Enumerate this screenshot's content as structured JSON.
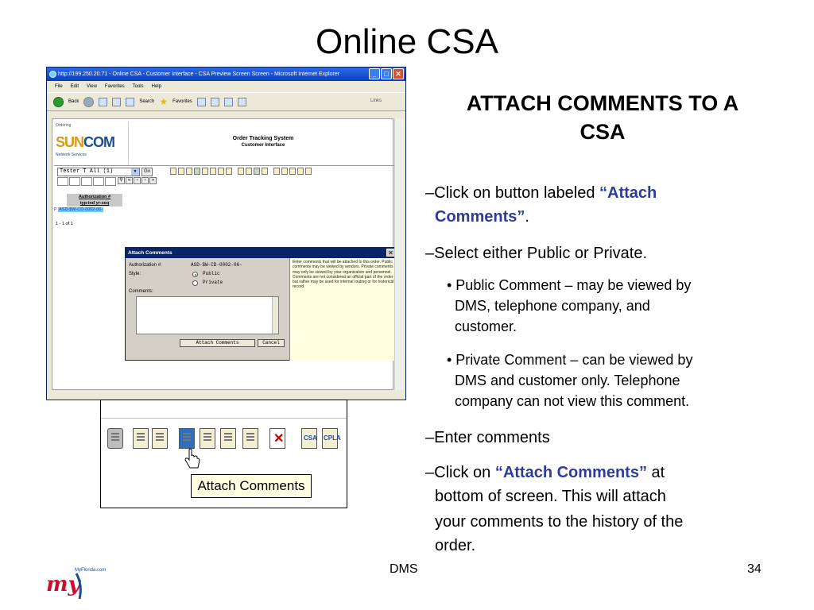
{
  "slide": {
    "title": "Online CSA",
    "heading_line1": "ATTACH COMMENTS TO A",
    "heading_line2": "CSA",
    "bullets": [
      {
        "prefix": "–Click on button labeled ",
        "highlight": "“Attach",
        "line2_highlight": "Comments”",
        "line2_suffix": "."
      },
      {
        "text": "–Select either Public or Private."
      },
      {
        "line1": "• Public Comment – may be viewed by",
        "line2": "DMS, telephone company, and",
        "line3": "customer."
      },
      {
        "line1": "• Private Comment – can be viewed by",
        "line2": "DMS and customer only. Telephone",
        "line3": "company can not view this comment."
      },
      {
        "text": "–Enter comments"
      },
      {
        "prefix": "–Click on ",
        "highlight": "“Attach Comments”",
        "suffix": " at",
        "line2": "bottom of screen.  This will attach",
        "line3": "your comments to the history of the",
        "line4": "order."
      }
    ],
    "footer_center": "DMS",
    "footer_page": "34",
    "footer_logo_text": "MyFlorida.com",
    "footer_logo_mark": "my"
  },
  "browser": {
    "title": "http://199.250.20.71 - Online CSA - Customer Interface - CSA Preview Screen Screen - Microsoft Internet Explorer",
    "menu": [
      "File",
      "Edit",
      "View",
      "Favorites",
      "Tools",
      "Help"
    ],
    "toolbar": {
      "back": "Back",
      "search": "Search",
      "favorites": "Favorites",
      "links": "Links"
    },
    "win_min": "_",
    "win_max": "□",
    "win_close": "✕"
  },
  "app": {
    "logo_small": "Ordering",
    "logo_main_a": "SUN",
    "logo_main_b": "COM",
    "logo_sub": "Network Services",
    "system_title": "Order Tracking System",
    "system_subtitle": "Customer Interface",
    "user_select": "Tester T  All (1)",
    "go_label": "Go",
    "auth_header_1": "Authorization #",
    "auth_header_2": "typ-ind  yr-seq",
    "auth_row_check": "P",
    "auth_row": "ASD-$W-CD-0002-06-",
    "auth_count": "1 - 1 of 1"
  },
  "dialog": {
    "title": "Attach Comments",
    "close": "✕",
    "auth_label": "Authorization #:",
    "auth_value": "ASD-$W-CD-0002-06-",
    "style_label": "Style:",
    "public_label": "Public",
    "private_label": "Private",
    "comments_label": "Comments:",
    "attach_button": "Attach Comments",
    "cancel_button": "Cancel",
    "help_text": "Enter comments that will be attached to this order. Public comments may be viewed by vendors. Private comments may only be viewed by your organization and personnel. Comments are not considered an official part of the order but rather may be used for internal routing or for historical record."
  },
  "zoom": {
    "csa_label": "CSA",
    "cpla_label": "CPLA",
    "tooltip": "Attach Comments"
  },
  "colors": {
    "accent": "#2e3c98",
    "ie_title": "#0a3fbf",
    "dialog_title": "#0a246a",
    "help_bg": "#ffffe1"
  }
}
